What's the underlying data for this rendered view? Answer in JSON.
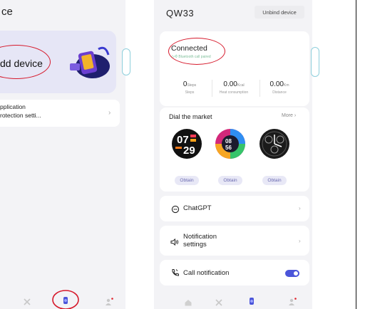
{
  "left_panel": {
    "title": "ce",
    "add_device_label": "dd device",
    "app_notification_line1": "pplication",
    "app_notification_line2": "rotection setti..."
  },
  "device": {
    "name": "QW33",
    "unbind_label": "Unbind device",
    "status": "Connected",
    "bluetooth_hint": "Bluetooth call paired"
  },
  "stats": [
    {
      "value": "0",
      "unit": "Steps",
      "label": "Steps"
    },
    {
      "value": "0.00",
      "unit": "Kcal",
      "label": "Heat consumption"
    },
    {
      "value": "0.00",
      "unit": "Km",
      "label": "Distance"
    }
  ],
  "dial_market": {
    "title": "Dial the market",
    "more_label": "More",
    "faces": [
      {
        "name": "face-digital",
        "time_top": "07",
        "time_bottom": "29",
        "obtain_label": "Obtain"
      },
      {
        "name": "face-colorful",
        "time_top": "08",
        "time_bottom": "56",
        "obtain_label": "Obtain"
      },
      {
        "name": "face-analog",
        "obtain_label": "Obtain"
      }
    ]
  },
  "menu": {
    "chatgpt_label": "ChatGPT",
    "notification_line1": "Notification",
    "notification_line2": "settings",
    "call_notification_label": "Call notification",
    "call_notification_enabled": true
  },
  "colors": {
    "accent": "#4b55d9",
    "annotation_red": "#d6192b",
    "panel_bg": "#f3f3f6",
    "card_bg": "#ffffff"
  },
  "icons": {
    "nav": [
      "home-icon",
      "sport-icon",
      "watch-icon",
      "profile-icon"
    ],
    "rows": [
      "chat-icon",
      "speaker-icon",
      "phone-icon"
    ]
  }
}
